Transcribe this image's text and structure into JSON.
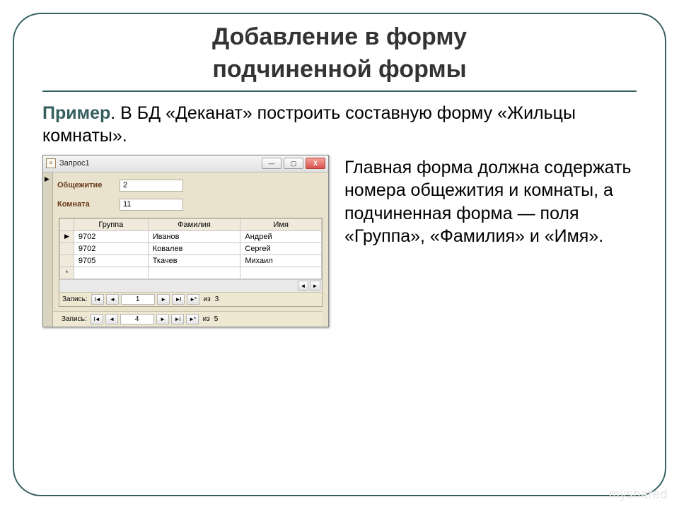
{
  "title_line1": "Добавление в форму",
  "title_line2": "подчиненной формы",
  "example_label": "Пример",
  "example_text": ". В БД «Деканат» построить составную форму «Жильцы комнаты».",
  "right_text": "Главная форма должна содержать номера общежития и комнаты, а подчиненная форма — поля  «Группа», «Фамилия» и «Имя».",
  "window": {
    "title": "Запрос1",
    "min": "—",
    "max": "▢",
    "close": "X"
  },
  "main": {
    "f1_label": "Общежитие",
    "f1_value": "2",
    "f2_label": "Комната",
    "f2_value": "11"
  },
  "sub_headers": {
    "c1": "Группа",
    "c2": "Фамилия",
    "c3": "Имя"
  },
  "sub_rows": [
    {
      "sel": "▶",
      "c1": "9702",
      "c2": "Иванов",
      "c3": "Андрей"
    },
    {
      "sel": "",
      "c1": "9702",
      "c2": "Ковалев",
      "c3": "Сергей"
    },
    {
      "sel": "",
      "c1": "9705",
      "c2": "Ткачев",
      "c3": "Михаил"
    },
    {
      "sel": "*",
      "c1": "",
      "c2": "",
      "c3": ""
    }
  ],
  "nav": {
    "label": "Запись:",
    "first": "I◄",
    "prev": "◄",
    "next": "►",
    "last": "►I",
    "new": "►*",
    "of": "из",
    "inner_pos": "1",
    "inner_total": "3",
    "outer_pos": "4",
    "outer_total": "5"
  },
  "watermark": "myshared"
}
